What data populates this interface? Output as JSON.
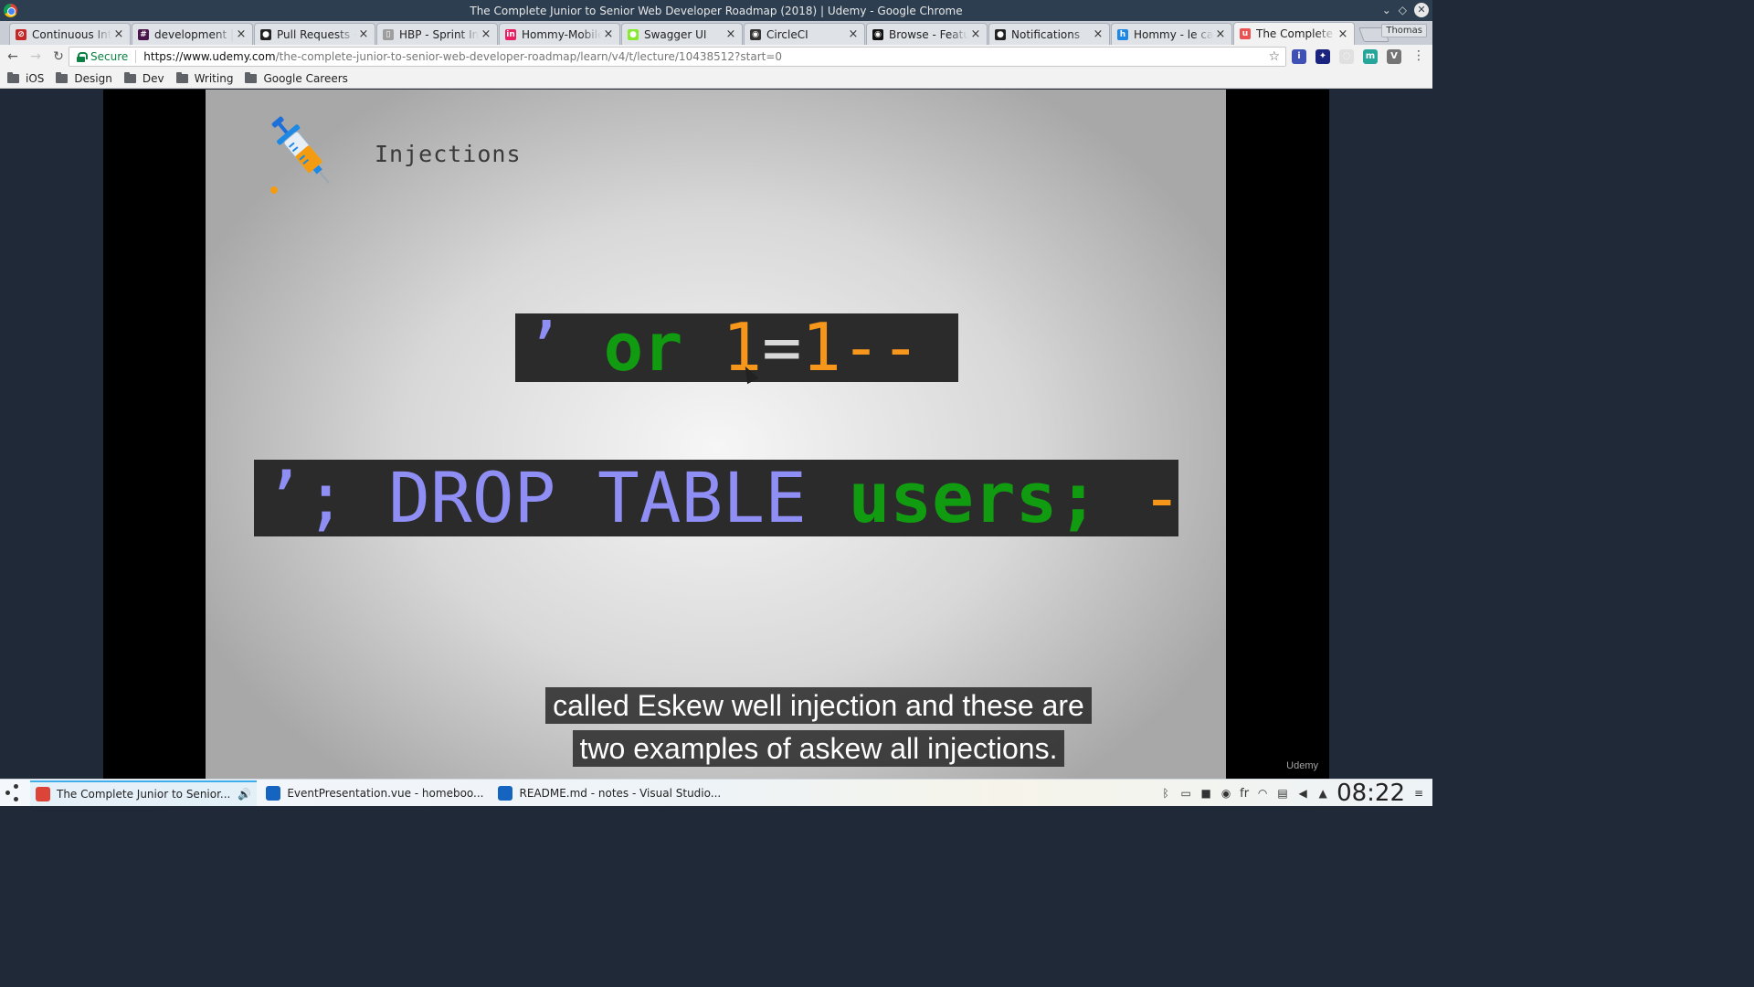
{
  "window": {
    "title": "The Complete Junior to Senior Web Developer Roadmap (2018) | Udemy - Google Chrome"
  },
  "tabs": [
    {
      "label": "Continuous Integ",
      "favicon_color": "#c62828",
      "favicon": "⊘",
      "close": "×"
    },
    {
      "label": "development | H",
      "favicon_color": "#4a154b",
      "favicon": "#",
      "close": "×"
    },
    {
      "label": "Pull Requests · ac",
      "favicon_color": "#222222",
      "favicon": "●",
      "close": "×"
    },
    {
      "label": "HBP - Sprint In pr",
      "favicon_color": "#9e9e9e",
      "favicon": "▯",
      "close": "×"
    },
    {
      "label": "Hommy-Mobile F",
      "favicon_color": "#e91e63",
      "favicon": "in",
      "close": "×"
    },
    {
      "label": "Swagger UI",
      "favicon_color": "#85ea2d",
      "favicon": "●",
      "close": "×"
    },
    {
      "label": "CircleCI",
      "favicon_color": "#333333",
      "favicon": "◉",
      "close": "×"
    },
    {
      "label": "Browse - Feature",
      "favicon_color": "#111111",
      "favicon": "◉",
      "close": "×"
    },
    {
      "label": "Notifications",
      "favicon_color": "#222222",
      "favicon": "●",
      "close": "×"
    },
    {
      "label": "Hommy - le carne",
      "favicon_color": "#1e88e5",
      "favicon": "h",
      "close": "×"
    },
    {
      "label": "The Complete",
      "favicon_color": "#ec5252",
      "favicon": "u",
      "close": "×",
      "active": true
    }
  ],
  "profile": "Thomas",
  "toolbar": {
    "back": "←",
    "forward": "→",
    "reload": "↻",
    "secure_label": "Secure",
    "url_host": "https://www.udemy.com",
    "url_path": "/the-complete-junior-to-senior-web-developer-roadmap/learn/v4/t/lecture/10438512?start=0",
    "star": "☆",
    "menu": "⋮"
  },
  "extensions": [
    {
      "name": "extension-1",
      "color": "#3f51b5",
      "glyph": "i"
    },
    {
      "name": "extension-2",
      "color": "#1a237e",
      "glyph": "✦"
    },
    {
      "name": "extension-3",
      "color": "#e0e0e0",
      "glyph": "◌"
    },
    {
      "name": "extension-4",
      "color": "#26a69a",
      "glyph": "m"
    },
    {
      "name": "extension-5",
      "color": "#757575",
      "glyph": "V"
    }
  ],
  "bookmarks": [
    "iOS",
    "Design",
    "Dev",
    "Writing",
    "Google Careers"
  ],
  "slide": {
    "title": "Injections",
    "code_line1": [
      {
        "text": "’ ",
        "color": "blue"
      },
      {
        "text": "or ",
        "color": "green"
      },
      {
        "text": "1",
        "color": "orange"
      },
      {
        "text": "=",
        "color": "grey"
      },
      {
        "text": "1--",
        "color": "orange"
      }
    ],
    "code_line2": [
      {
        "text": "’; DROP TABLE ",
        "color": "blue"
      },
      {
        "text": "users; ",
        "color": "green"
      },
      {
        "text": "--",
        "color": "orange"
      }
    ],
    "caption_line1": "called Eskew well injection and these are",
    "caption_line2": "two examples of askew all injections.",
    "watermark": "Udemy"
  },
  "taskbar": {
    "tasks": [
      {
        "label": "The Complete Junior to Senior...",
        "icon_color": "#db4437",
        "active": true
      },
      {
        "label": "EventPresentation.vue - homeboo...",
        "icon_color": "#1565c0"
      },
      {
        "label": "README.md - notes - Visual Studio...",
        "icon_color": "#1565c0"
      }
    ],
    "audio_icon": "🔊",
    "keyboard_layout": "fr",
    "clock": "08:22"
  },
  "colors": {
    "code_blue": "#8f8ef5",
    "code_green": "#119b11",
    "code_orange": "#f6961a",
    "code_bg": "#2b2b2b"
  }
}
